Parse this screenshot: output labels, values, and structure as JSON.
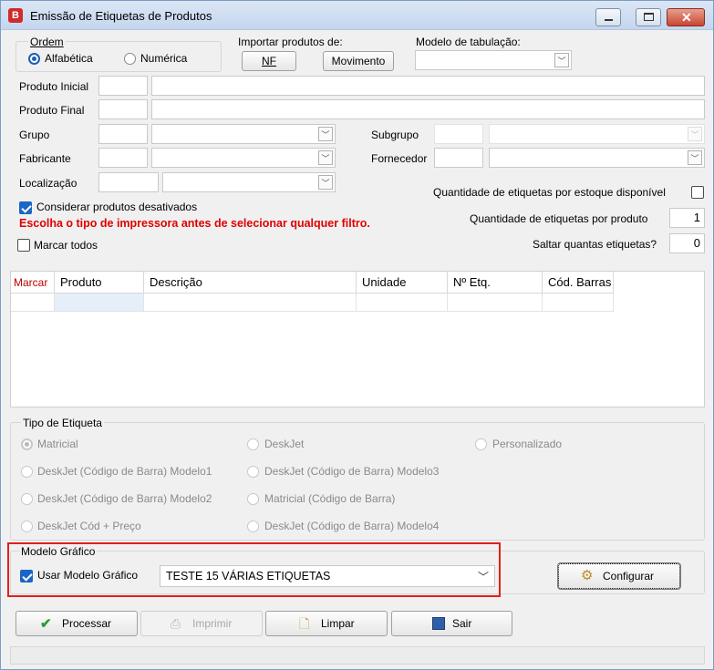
{
  "window": {
    "title": "Emissão de Etiquetas de Produtos",
    "app_icon_letter": "B"
  },
  "ordem": {
    "legend": "Ordem",
    "options": [
      "Alfabética",
      "Numérica"
    ],
    "selected": "Alfabética"
  },
  "importar": {
    "label": "Importar produtos de:",
    "nf_button": "NF",
    "movimento_button": "Movimento"
  },
  "modelo_tabulacao": {
    "label": "Modelo de tabulação:",
    "value": ""
  },
  "filters": {
    "produto_inicial": "Produto Inicial",
    "produto_final": "Produto Final",
    "grupo": "Grupo",
    "subgrupo": "Subgrupo",
    "fabricante": "Fabricante",
    "fornecedor": "Fornecedor",
    "localizacao": "Localização"
  },
  "options": {
    "considerar_desativados": "Considerar produtos desativados",
    "warning": "Escolha o tipo de impressora antes de selecionar qualquer filtro.",
    "marcar_todos": "Marcar todos",
    "qtd_estoque": "Quantidade de etiquetas por estoque disponível",
    "qtd_por_produto_label": "Quantidade de etiquetas por produto",
    "qtd_por_produto_value": "1",
    "saltar_label": "Saltar quantas etiquetas?",
    "saltar_value": "0"
  },
  "grid": {
    "columns": [
      "Marcar",
      "Produto",
      "Descrição",
      "Unidade",
      "Nº Etq.",
      "Cód. Barras"
    ]
  },
  "tipo_etiqueta": {
    "legend": "Tipo de Etiqueta",
    "options": [
      "Matricial",
      "DeskJet",
      "Personalizado",
      "DeskJet (Código de Barra) Modelo1",
      "DeskJet (Código de Barra) Modelo3",
      "DeskJet (Código de Barra) Modelo2",
      "Matricial (Código de Barra)",
      "DeskJet Cód + Preço",
      "DeskJet (Código de Barra) Modelo4"
    ]
  },
  "modelo_grafico": {
    "legend": "Modelo Gráfico",
    "usar_label": "Usar Modelo Gráfico",
    "selected": "TESTE 15 VÁRIAS ETIQUETAS",
    "configurar_button": "Configurar"
  },
  "actions": {
    "processar": "Processar",
    "imprimir": "Imprimir",
    "limpar": "Limpar",
    "sair": "Sair"
  },
  "colors": {
    "warning_red": "#e00000",
    "highlight_border": "#e0201c",
    "accent_blue": "#1a66c6"
  }
}
